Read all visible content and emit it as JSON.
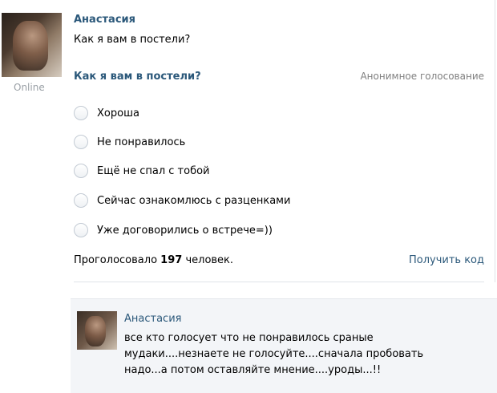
{
  "post": {
    "author": "Анастасия",
    "status": "Online",
    "text": "Как я вам в постели?"
  },
  "poll": {
    "question": "Как я вам в постели?",
    "type_label": "Анонимное голосование",
    "options": [
      "Хороша",
      "Не понравилось",
      "Ещё не спал с тобой",
      "Сейчас ознакомлюсь с разценками",
      "Уже договорились о встрече=))"
    ],
    "votes_prefix": "Проголосовало",
    "votes_count": "197",
    "votes_suffix": "человек.",
    "get_code_label": "Получить код"
  },
  "comment": {
    "author": "Анастасия",
    "text_lines": [
      "все кто голосует что не понравилось сраные",
      "мудаки....незнаете не голосуйте....сначала пробовать",
      "надо...а потом оставляйте мнение....уроды...!!"
    ]
  },
  "colors": {
    "link": "#2b587a",
    "muted": "#7f7f7f",
    "comment_bg": "#f3f5f8"
  }
}
